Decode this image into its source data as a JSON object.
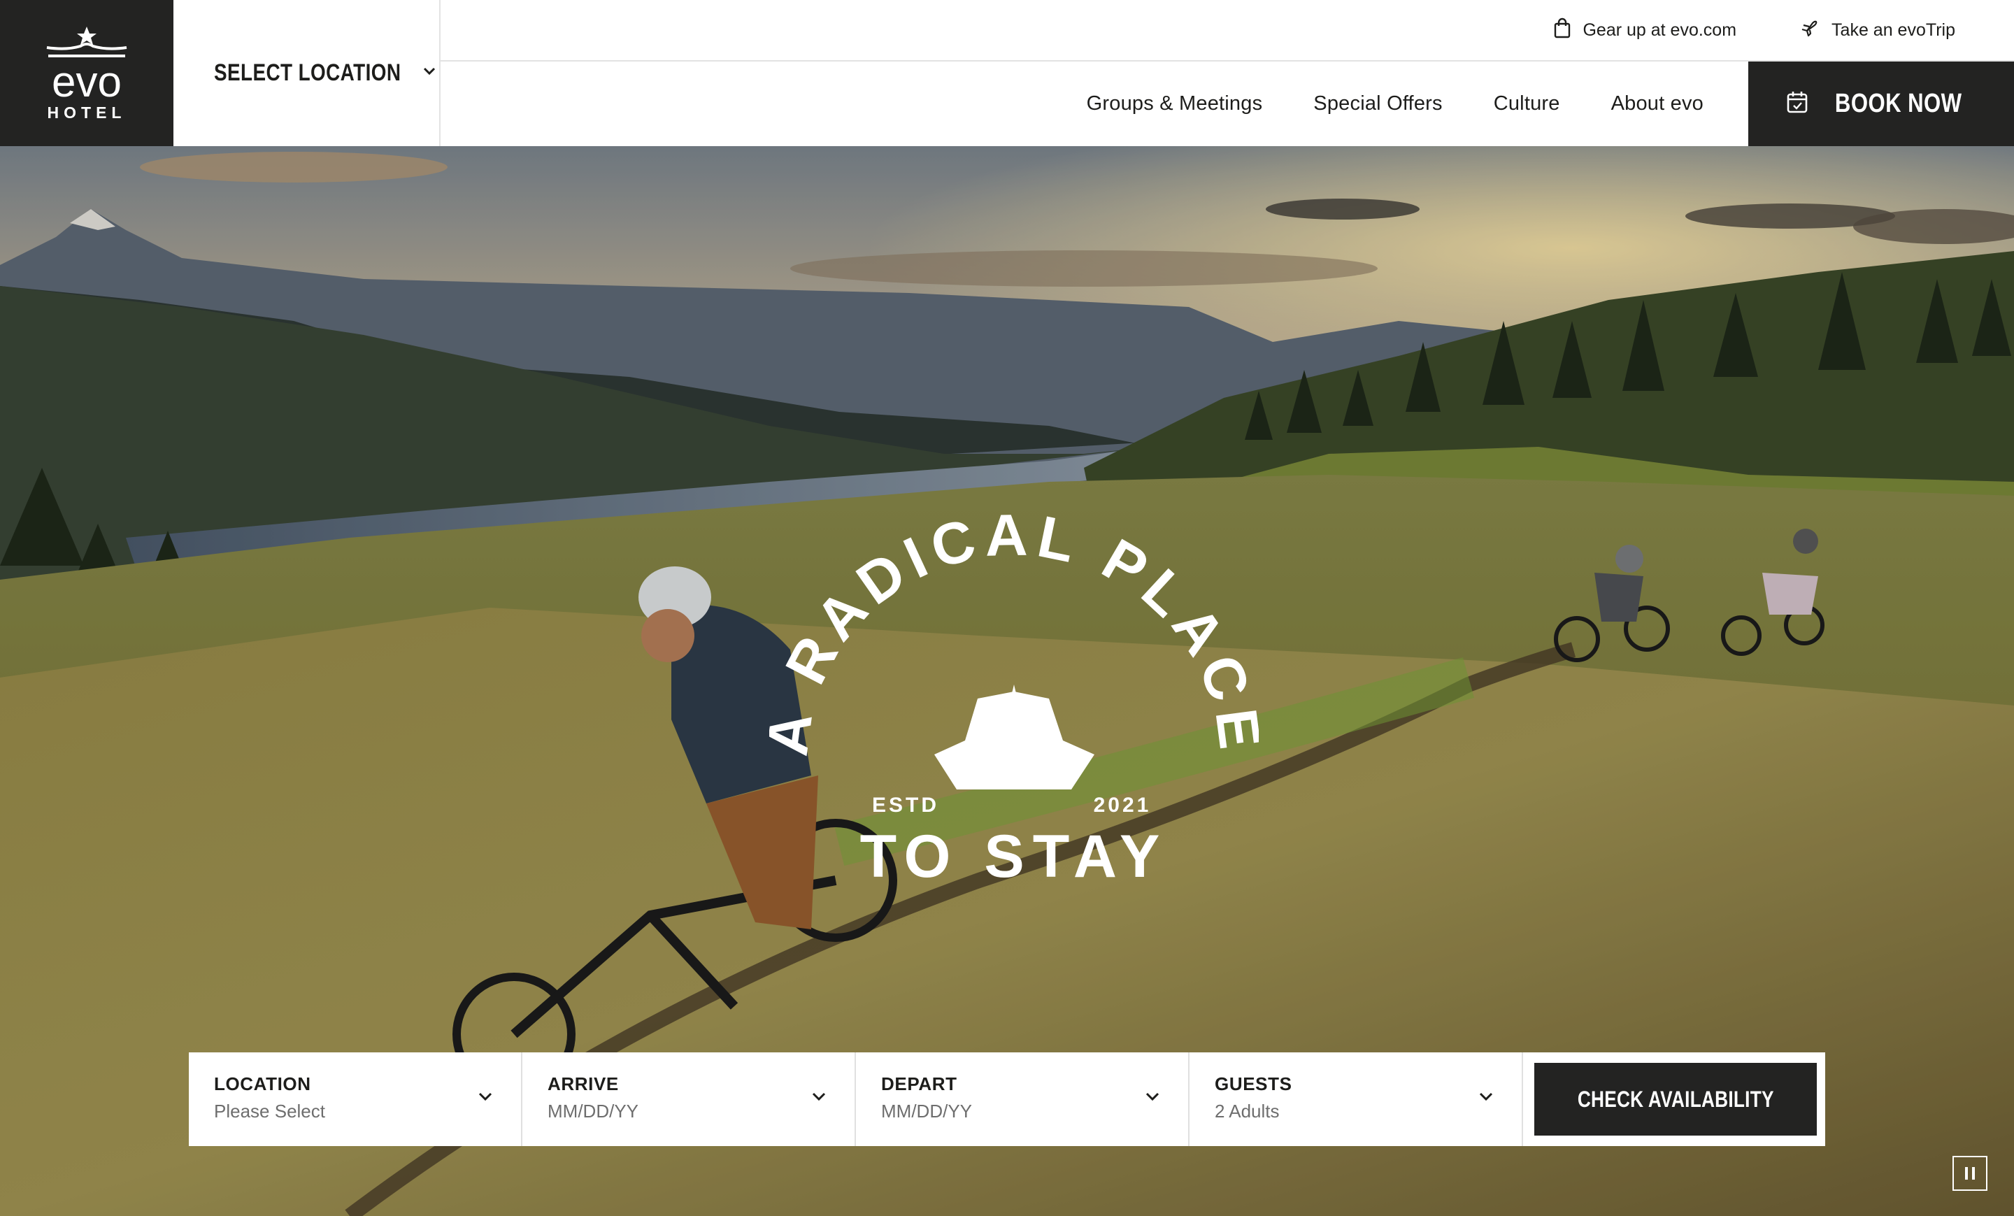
{
  "brand": {
    "logo_word": "evo",
    "logo_sub": "HOTEL"
  },
  "location_selector": {
    "label": "SELECT LOCATION"
  },
  "topbar": {
    "links": [
      {
        "label": "Gear up at evo.com",
        "icon": "shopping-bag-icon"
      },
      {
        "label": "Take an evoTrip",
        "icon": "airplane-icon"
      }
    ]
  },
  "nav": {
    "items": [
      {
        "label": "Groups & Meetings"
      },
      {
        "label": "Special Offers"
      },
      {
        "label": "Culture"
      },
      {
        "label": "About evo"
      }
    ],
    "book_now": "BOOK NOW"
  },
  "hero": {
    "badge_arc": "A RADICAL PLACE",
    "badge_line": "TO STAY",
    "badge_estd": "ESTD",
    "badge_year": "2021"
  },
  "booking": {
    "fields": [
      {
        "label": "LOCATION",
        "value": "Please Select"
      },
      {
        "label": "ARRIVE",
        "value": "MM/DD/YY"
      },
      {
        "label": "DEPART",
        "value": "MM/DD/YY"
      },
      {
        "label": "GUESTS",
        "value": "2 Adults"
      }
    ],
    "cta": "CHECK AVAILABILITY"
  },
  "colors": {
    "dark": "#232322",
    "white": "#ffffff",
    "muted": "#6e6e6e"
  }
}
